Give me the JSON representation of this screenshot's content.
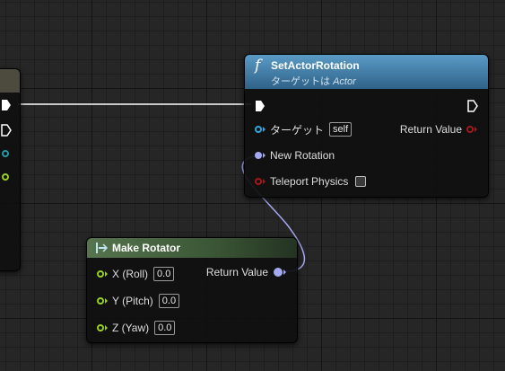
{
  "set_node": {
    "title": "SetActorRotation",
    "subtitle_prefix": "ターゲットは ",
    "subtitle_target": "Actor",
    "function_icon": "f",
    "pins": {
      "target_label": "ターゲット",
      "target_value": "self",
      "return_label": "Return Value",
      "new_rotation_label": "New Rotation",
      "teleport_label": "Teleport Physics",
      "teleport_checked": false
    },
    "header_color": "#3f7ba3"
  },
  "make_node": {
    "title": "Make Rotator",
    "header_color": "#3b5636",
    "pins": {
      "x_label": "X (Roll)",
      "x_value": "0.0",
      "y_label": "Y (Pitch)",
      "y_value": "0.0",
      "z_label": "Z (Yaw)",
      "z_value": "0.0",
      "return_label": "Return Value"
    }
  },
  "colors": {
    "exec": "#ffffff",
    "object_pin": "#2fa7d9",
    "bool_pin": "#a51818",
    "float_pin": "#9ad11d",
    "rotator_pin": "#a3a8f1",
    "rotator_wire": "#a3a8f1"
  },
  "icons": {
    "exec_pin": "exec-arrow-icon",
    "function": "function-f-icon",
    "make_struct": "make-struct-icon"
  }
}
